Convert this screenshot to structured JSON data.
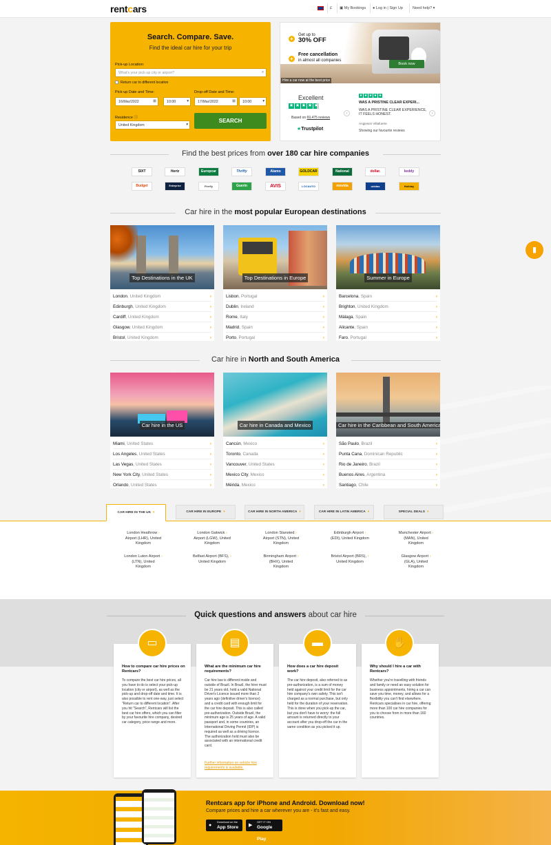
{
  "header": {
    "logo_pre": "rent",
    "logo_o": "c",
    "logo_post": "ars",
    "currency": "£",
    "my_bookings": "My Bookings",
    "login": "Log in | Sign Up",
    "help": "Need help?"
  },
  "search": {
    "title": "Search. Compare. Save.",
    "subtitle": "Find the ideal car hire for your trip",
    "pickup_label": "Pick-up Location:",
    "pickup_placeholder": "What's your pick-up city or airport?",
    "return_label": "Return car to different location",
    "pickup_date_label": "Pick-up Date and Time:",
    "dropoff_date_label": "Drop-off Date and Time:",
    "pickup_date": "16/Mar/2022",
    "pickup_time": "10:00",
    "dropoff_date": "17/Mar/2022",
    "dropoff_time": "10:00",
    "residence_label": "Residence",
    "residence_value": "United Kingdom",
    "search_button": "SEARCH"
  },
  "promo": {
    "get_up_to": "Get up to",
    "discount": "30% OFF",
    "free_cancel": "Free cancellation",
    "free_cancel_sub": "in almost all companies",
    "book_now": "Book now",
    "banner_note": "Hire a car now at the best price",
    "rating_word": "Excellent",
    "based_on": "Based on",
    "reviews_link": "69,475 reviews",
    "trustpilot": "Trustpilot",
    "review_title": "WAS A PRISTINE CLEAR EXPERI...",
    "review_text": "WAS A PRISTINE CLEAR EXPERIENCE, IT FEELS HONEST.",
    "reviewer": "Angieson Villafuerte",
    "showing": "Showing our favourite reviews"
  },
  "companies": {
    "title_pre": "Find the best prices from ",
    "title_bold": "over 180 car hire companies",
    "logos": [
      "SIXT",
      "Hertz",
      "Europcar",
      "Thrifty",
      "Alamo",
      "GOLDCAR",
      "National",
      "dollar.",
      "keddy",
      "Budget",
      "Enterprise",
      "Firefly",
      "Guerin",
      "AVIS",
      "LOCAUTO",
      "movida",
      "unidas",
      "Holiday"
    ]
  },
  "europe": {
    "title_pre": "Car hire in the ",
    "title_bold": "most popular European destinations",
    "cards": [
      {
        "caption": "Top Destinations in the UK",
        "rows": [
          [
            "London",
            ", United Kingdom"
          ],
          [
            "Edinburgh",
            ", United Kingdom"
          ],
          [
            "Cardiff",
            ", United Kingdom"
          ],
          [
            "Glasgow",
            ", United Kingdom"
          ],
          [
            "Bristol",
            ", United Kingdom"
          ]
        ]
      },
      {
        "caption": "Top Destinations in Europe",
        "rows": [
          [
            "Lisbon",
            ", Portugal"
          ],
          [
            "Dublin",
            ", Ireland"
          ],
          [
            "Rome",
            ", Italy"
          ],
          [
            "Madrid",
            ", Spain"
          ],
          [
            "Porto",
            ", Portugal"
          ]
        ]
      },
      {
        "caption": "Summer in Europe",
        "rows": [
          [
            "Barcelona",
            ", Spain"
          ],
          [
            "Brighton",
            ", United Kingdom"
          ],
          [
            "Málaga",
            ", Spain"
          ],
          [
            "Alicante",
            ", Spain"
          ],
          [
            "Faro",
            ", Portugal"
          ]
        ]
      }
    ]
  },
  "americas": {
    "title_pre": "Car hire in ",
    "title_bold": "North and South America",
    "cards": [
      {
        "caption": "Car hire in the US",
        "rows": [
          [
            "Miami",
            ", United States"
          ],
          [
            "Los Angeles",
            ", United States"
          ],
          [
            "Las Vegas",
            ", United States"
          ],
          [
            "New York City",
            ", United States"
          ],
          [
            "Orlando",
            ", United States"
          ]
        ]
      },
      {
        "caption": "Car hire in Canada and Mexico",
        "rows": [
          [
            "Cancún",
            ", Mexico"
          ],
          [
            "Toronto",
            ", Canada"
          ],
          [
            "Vancouver",
            ", United States"
          ],
          [
            "Mexico City",
            ", Mexico"
          ],
          [
            "Mérida",
            ", Mexico"
          ]
        ]
      },
      {
        "caption": "Car hire in the Caribbean and South America",
        "rows": [
          [
            "São Paulo",
            ", Brazil"
          ],
          [
            "Punta Cana",
            ", Dominican Republic"
          ],
          [
            "Rio de Janeiro",
            ", Brazil"
          ],
          [
            "Buenos Aires",
            ", Argentina"
          ],
          [
            "Santiago",
            ", Chile"
          ]
        ]
      }
    ]
  },
  "tabs": [
    "CAR HIRE IN THE UK",
    "CAR HIRE IN EUROPE",
    "CAR HIRE IN NORTH AMERICA",
    "CAR HIRE IN LATIN AMERICA",
    "SPECIAL DEALS"
  ],
  "airports": [
    [
      "London Heathrow",
      "Airport (LHR), United",
      "Kingdom"
    ],
    [
      "London Gatwick",
      "Airport (LGW), United",
      "Kingdom"
    ],
    [
      "London Stansted",
      "Airport (STN), United",
      "Kingdom"
    ],
    [
      "Edinburgh Airport",
      "(EDI), United Kingdom",
      ""
    ],
    [
      "Manchester Airport",
      "(MAN), United",
      "Kingdom"
    ],
    [
      "London Luton Airport",
      "(LTN), United",
      "Kingdom"
    ],
    [
      "Belfast Airport (BFS),",
      "United Kingdom",
      ""
    ],
    [
      "Birmingham Airport",
      "(BHX), United",
      "Kingdom"
    ],
    [
      "Bristol Airport (BRS),",
      "United Kingdom",
      ""
    ],
    [
      "Glasgow Airport",
      "(GLA), United",
      "Kingdom"
    ]
  ],
  "faq": {
    "title_bold": "Quick questions and answers",
    "title_post": " about car hire",
    "cards": [
      {
        "q": "How to compare car hire prices on Rentcars?",
        "a": "To compare the best car hire prices, all you have to do is select your pick-up location (city or airport), as well as the pick-up and drop-off date and time. It is also possible to rent one-way, just select \"Return car to different location\". After you hit \"Search\", Rentcars will list the best car hire offers, which you can filter by your favourite hire company, desired car category, price range and more.",
        "link": ""
      },
      {
        "q": "What are the minimum car hire requirements?",
        "a": "Car hire law is different inside and outside of Brazil. In Brazil, the hirer must be 21 years old, hold a valid National Driver's Licence issued more than 2 years ago (definitive driver's licence) and a credit card with enough limit for the car hire deposit. This is also called pre-authorization. Outside Brazil, the minimum age is 25 years of age. A valid passport and, in some countries, an International Driving Permit (IDP) is required as well as a driving licence. The authorization hold must also be associated with an international credit card.",
        "link": "Further information on vehicle hire requirements is available."
      },
      {
        "q": "How does a car hire deposit work?",
        "a": "The car hire deposit, also referred to as pre-authorization, is a sum of money held against your credit limit for the car hire company's own safety. This isn't charged as a normal purchase, but only held for the duration of your reservation. This is done when you pick-up the car, but you don't have to worry: the full amount is returned directly to your account after you drop-off the car in the same condition as you picked it up.",
        "link": ""
      },
      {
        "q": "Why should I hire a car with Rentcars?",
        "a": "Whether you're travelling with friends and family or need an easy solution for business appointments, hiring a car can save you time, money, and allows for a flexibility you can't find elsewhere. Rentcars specialises in car hire, offering more than 100 car hire companies for you to choose from in more than 160 countries.",
        "link": ""
      }
    ]
  },
  "app": {
    "title": "Rentcars app for iPhone and Android. Download now!",
    "subtitle": "Compare prices and hire a car wherever you are - it's fast and easy.",
    "appstore_small": "Download on the",
    "appstore": "App Store",
    "play_small": "GET IT ON",
    "play": "Google Play"
  }
}
